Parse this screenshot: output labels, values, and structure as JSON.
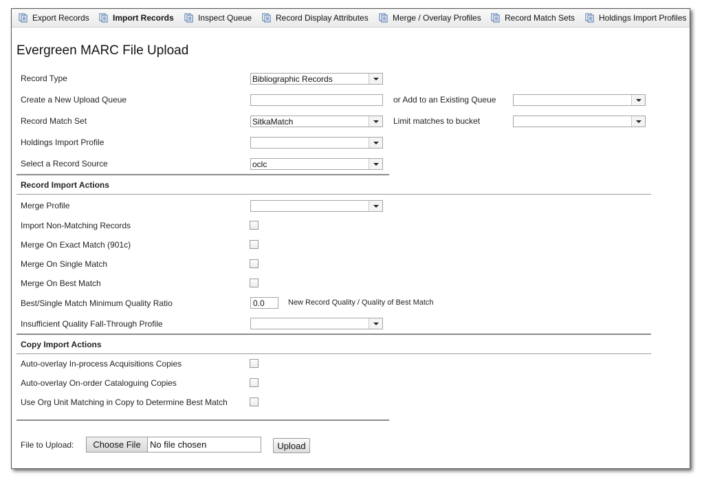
{
  "toolbar": {
    "items": [
      {
        "label": "Export Records",
        "icon": "document-copy-icon",
        "bold": false
      },
      {
        "label": "Import Records",
        "icon": "document-copy-icon",
        "bold": true
      },
      {
        "label": "Inspect Queue",
        "icon": "document-copy-icon",
        "bold": false
      },
      {
        "label": "Record Display Attributes",
        "icon": "document-copy-icon",
        "bold": false
      },
      {
        "label": "Merge / Overlay Profiles",
        "icon": "document-copy-icon",
        "bold": false
      },
      {
        "label": "Record Match Sets",
        "icon": "document-copy-icon",
        "bold": false
      },
      {
        "label": "Holdings Import Profiles",
        "icon": "document-copy-icon",
        "bold": false
      }
    ]
  },
  "page": {
    "title": "Evergreen MARC File Upload"
  },
  "form": {
    "record_type": {
      "label": "Record Type",
      "value": "Bibliographic Records"
    },
    "new_queue": {
      "label": "Create a New Upload Queue",
      "value": ""
    },
    "existing_queue": {
      "label": "or Add to an Existing Queue",
      "value": ""
    },
    "match_set": {
      "label": "Record Match Set",
      "value": "SitkaMatch"
    },
    "limit_bucket": {
      "label": "Limit matches to bucket",
      "value": ""
    },
    "holdings_profile": {
      "label": "Holdings Import Profile",
      "value": ""
    },
    "record_source": {
      "label": "Select a Record Source",
      "value": "oclc"
    }
  },
  "record_actions": {
    "heading": "Record Import Actions",
    "merge_profile": {
      "label": "Merge Profile",
      "value": ""
    },
    "import_non_matching": {
      "label": "Import Non-Matching Records",
      "checked": false
    },
    "merge_exact": {
      "label": "Merge On Exact Match (901c)",
      "checked": false
    },
    "merge_single": {
      "label": "Merge On Single Match",
      "checked": false
    },
    "merge_best": {
      "label": "Merge On Best Match",
      "checked": false
    },
    "quality_ratio": {
      "label": "Best/Single Match Minimum Quality Ratio",
      "value": "0.0",
      "hint": "New Record Quality / Quality of Best Match"
    },
    "fall_through": {
      "label": "Insufficient Quality Fall-Through Profile",
      "value": ""
    }
  },
  "copy_actions": {
    "heading": "Copy Import Actions",
    "auto_overlay_inprocess": {
      "label": "Auto-overlay In-process Acquisitions Copies",
      "checked": false
    },
    "auto_overlay_onorder": {
      "label": "Auto-overlay On-order Cataloguing Copies",
      "checked": false
    },
    "org_unit_matching": {
      "label": "Use Org Unit Matching in Copy to Determine Best Match",
      "checked": false
    }
  },
  "upload": {
    "label": "File to Upload:",
    "choose_label": "Choose File",
    "file_name": "No file chosen",
    "upload_label": "Upload"
  }
}
